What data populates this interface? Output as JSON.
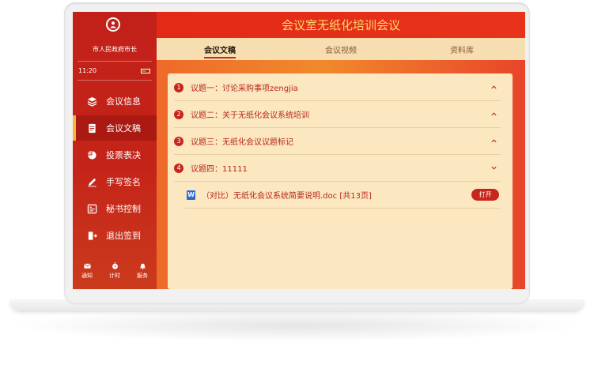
{
  "sidebar": {
    "user_title": "市人民政府市长",
    "time": "11:20",
    "items": [
      {
        "label": "会议信息",
        "icon": "layers-icon"
      },
      {
        "label": "会议文稿",
        "icon": "document-icon"
      },
      {
        "label": "投票表决",
        "icon": "pie-chart-icon"
      },
      {
        "label": "手写签名",
        "icon": "pen-icon"
      },
      {
        "label": "秘书控制",
        "icon": "control-panel-icon"
      },
      {
        "label": "退出签到",
        "icon": "exit-icon"
      }
    ],
    "active_index": 1,
    "tools": [
      {
        "label": "通知",
        "icon": "envelope-icon"
      },
      {
        "label": "计时",
        "icon": "timer-icon"
      },
      {
        "label": "服务",
        "icon": "bell-icon"
      }
    ]
  },
  "header": {
    "title": "会议室无纸化培训会议"
  },
  "tabs": [
    "会议文稿",
    "会议视频",
    "资料库"
  ],
  "topics": [
    {
      "num": "1",
      "title": "议题一：讨论采购事项zengjia",
      "expanded": false
    },
    {
      "num": "2",
      "title": "议题二：关于无纸化会议系统培训",
      "expanded": false
    },
    {
      "num": "3",
      "title": "议题三：无纸化会议议题标记",
      "expanded": false
    },
    {
      "num": "4",
      "title": "议题四：11111",
      "expanded": true
    }
  ],
  "file": {
    "name": "（对比）无纸化会议系统简要说明.doc [共13页]",
    "icon_glyph": "W",
    "open_label": "打开"
  },
  "colors": {
    "primary_red": "#c8261c",
    "title_gold": "#ffd66e",
    "panel_bg": "#fbe8c0"
  }
}
